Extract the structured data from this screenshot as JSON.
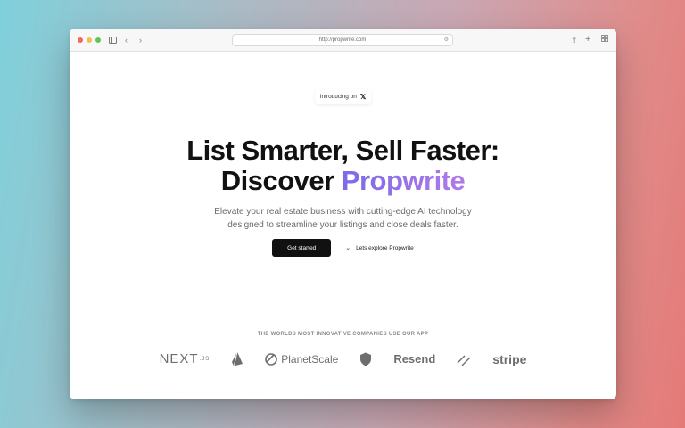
{
  "browser": {
    "url": "http://propwrite.com",
    "icons": [
      "sidebar-icon",
      "back-icon",
      "forward-icon",
      "page-settings-icon",
      "share-icon",
      "new-tab-icon",
      "tab-overview-icon"
    ]
  },
  "hero": {
    "intro_label": "Introducing on",
    "intro_icon": "x-logo-icon",
    "headline_line1": "List Smarter, Sell Faster:",
    "headline_line2_prefix": "Discover",
    "headline_accent": "Propwrite",
    "subtitle_line1": "Elevate your real estate business with cutting-edge AI technology",
    "subtitle_line2": "designed to streamline your listings and close deals faster.",
    "primary_cta": "Get started",
    "secondary_cta": "Lets explore Propwrite"
  },
  "companies": {
    "title": "THE WORLDS MOST INNOVATIVE COMPANIES USE OUR APP",
    "logos": [
      {
        "name": "NEXT",
        "suffix": ".JS"
      },
      {
        "name": "prisma-logo"
      },
      {
        "name": "PlanetScale"
      },
      {
        "name": "shield-logo"
      },
      {
        "name": "Resend"
      },
      {
        "name": "slash-logo"
      },
      {
        "name": "stripe"
      }
    ]
  },
  "colors": {
    "accent_start": "#7b6be6",
    "accent_end": "#b07ae8",
    "button": "#111111"
  }
}
